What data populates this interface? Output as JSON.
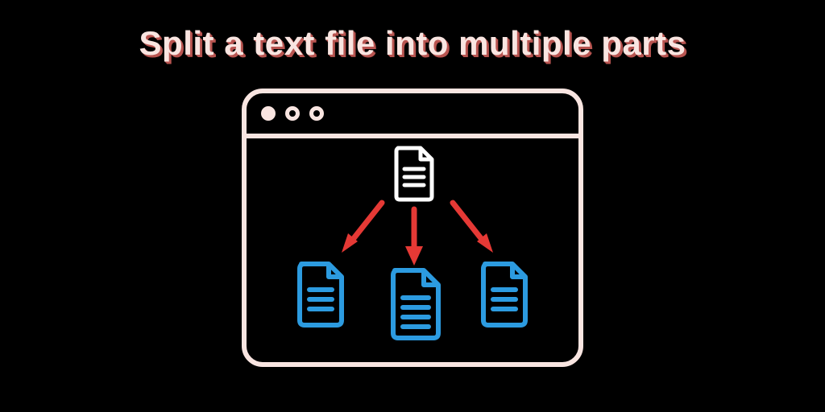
{
  "title": "Split a text file into multiple parts",
  "colors": {
    "background": "#000000",
    "frame": "#F9E5E1",
    "title_text": "#F9E5E1",
    "title_shadow": "#B85450",
    "source_doc": "#FFFFFF",
    "split_doc": "#2C9BE0",
    "arrow": "#E53935"
  },
  "diagram": {
    "window": {
      "toolbar_dots": [
        "filled",
        "outline",
        "outline"
      ]
    },
    "source": {
      "type": "document",
      "color": "white"
    },
    "arrows": 3,
    "outputs": [
      {
        "type": "document",
        "color": "blue"
      },
      {
        "type": "document",
        "color": "blue"
      },
      {
        "type": "document",
        "color": "blue"
      }
    ]
  }
}
